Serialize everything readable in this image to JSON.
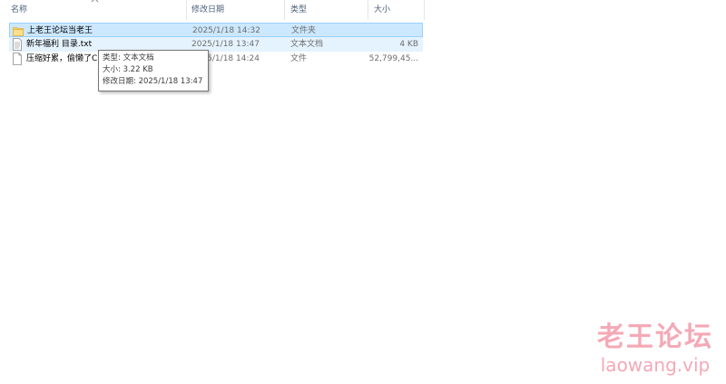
{
  "columns": {
    "name": "名称",
    "date": "修改日期",
    "type": "类型",
    "size": "大小"
  },
  "files": [
    {
      "name": "上老王论坛当老王",
      "date": "2025/1/18 14:32",
      "type": "文件夹",
      "size": "",
      "icon": "folder-icon"
    },
    {
      "name": "新年福利 目录.txt",
      "date": "2025/1/18 13:47",
      "type": "文本文档",
      "size": "4 KB",
      "icon": "text-file-icon"
    },
    {
      "name": "压缩好累，偷懒了C",
      "date": "2025/1/18 14:24",
      "type": "文件",
      "size": "52,799,45...",
      "icon": "file-icon"
    }
  ],
  "tooltip": {
    "type": "类型: 文本文档",
    "size": "大小: 3.22 KB",
    "modified": "修改日期: 2025/1/18 13:47"
  },
  "watermark": {
    "title": "老王论坛",
    "url": "laowang.vip"
  },
  "colors": {
    "selected_bg": "#cce8ff",
    "selected_border": "#99d1ff",
    "hover_bg": "#e5f3ff",
    "header_text": "#4c607a",
    "watermark": "#f4a9b6"
  }
}
